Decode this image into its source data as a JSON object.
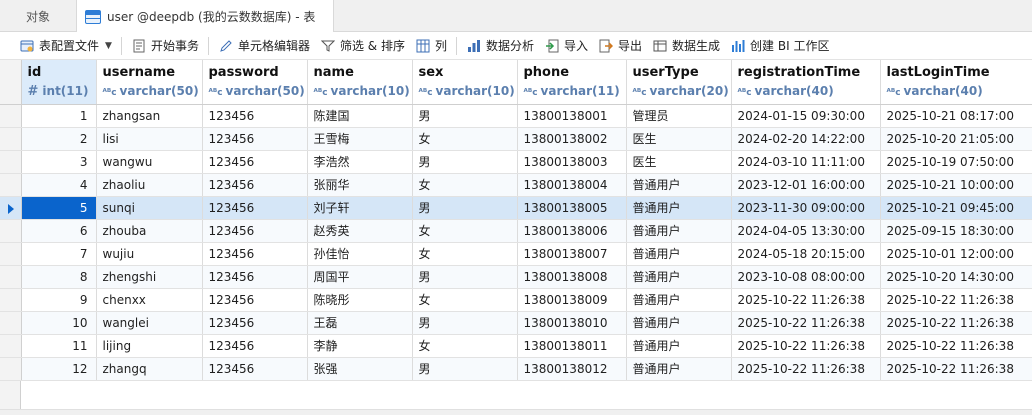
{
  "tabs": {
    "objects": "对象",
    "table": "user @deepdb (我的云数数据库) - 表"
  },
  "toolbar": {
    "table_config": "表配置文件",
    "begin_tx": "开始事务",
    "cell_editor": "单元格编辑器",
    "filter_sort": "筛选 & 排序",
    "columns": "列",
    "data_analysis": "数据分析",
    "import": "导入",
    "export": "导出",
    "data_gen": "数据生成",
    "create_bi": "创建 BI 工作区"
  },
  "columns": [
    {
      "name": "id",
      "type": "int(11)"
    },
    {
      "name": "username",
      "type": "varchar(50)"
    },
    {
      "name": "password",
      "type": "varchar(50)"
    },
    {
      "name": "name",
      "type": "varchar(10)"
    },
    {
      "name": "sex",
      "type": "varchar(10)"
    },
    {
      "name": "phone",
      "type": "varchar(11)"
    },
    {
      "name": "userType",
      "type": "varchar(20)"
    },
    {
      "name": "registrationTime",
      "type": "varchar(40)"
    },
    {
      "name": "lastLoginTime",
      "type": "varchar(40)"
    }
  ],
  "rows": [
    [
      "1",
      "zhangsan",
      "123456",
      "陈建国",
      "男",
      "13800138001",
      "管理员",
      "2024-01-15 09:30:00",
      "2025-10-21 08:17:00"
    ],
    [
      "2",
      "lisi",
      "123456",
      "王雪梅",
      "女",
      "13800138002",
      "医生",
      "2024-02-20 14:22:00",
      "2025-10-20 21:05:00"
    ],
    [
      "3",
      "wangwu",
      "123456",
      "李浩然",
      "男",
      "13800138003",
      "医生",
      "2024-03-10 11:11:00",
      "2025-10-19 07:50:00"
    ],
    [
      "4",
      "zhaoliu",
      "123456",
      "张丽华",
      "女",
      "13800138004",
      "普通用户",
      "2023-12-01 16:00:00",
      "2025-10-21 10:00:00"
    ],
    [
      "5",
      "sunqi",
      "123456",
      "刘子轩",
      "男",
      "13800138005",
      "普通用户",
      "2023-11-30 09:00:00",
      "2025-10-21 09:45:00"
    ],
    [
      "6",
      "zhouba",
      "123456",
      "赵秀英",
      "女",
      "13800138006",
      "普通用户",
      "2024-04-05 13:30:00",
      "2025-09-15 18:30:00"
    ],
    [
      "7",
      "wujiu",
      "123456",
      "孙佳怡",
      "女",
      "13800138007",
      "普通用户",
      "2024-05-18 20:15:00",
      "2025-10-01 12:00:00"
    ],
    [
      "8",
      "zhengshi",
      "123456",
      "周国平",
      "男",
      "13800138008",
      "普通用户",
      "2023-10-08 08:00:00",
      "2025-10-20 14:30:00"
    ],
    [
      "9",
      "chenxx",
      "123456",
      "陈晓彤",
      "女",
      "13800138009",
      "普通用户",
      "2025-10-22 11:26:38",
      "2025-10-22 11:26:38"
    ],
    [
      "10",
      "wanglei",
      "123456",
      "王磊",
      "男",
      "13800138010",
      "普通用户",
      "2025-10-22 11:26:38",
      "2025-10-22 11:26:38"
    ],
    [
      "11",
      "lijing",
      "123456",
      "李静",
      "女",
      "13800138011",
      "普通用户",
      "2025-10-22 11:26:38",
      "2025-10-22 11:26:38"
    ],
    [
      "12",
      "zhangq",
      "123456",
      "张强",
      "男",
      "13800138012",
      "普通用户",
      "2025-10-22 11:26:38",
      "2025-10-22 11:26:38"
    ]
  ],
  "selected_row": 5
}
